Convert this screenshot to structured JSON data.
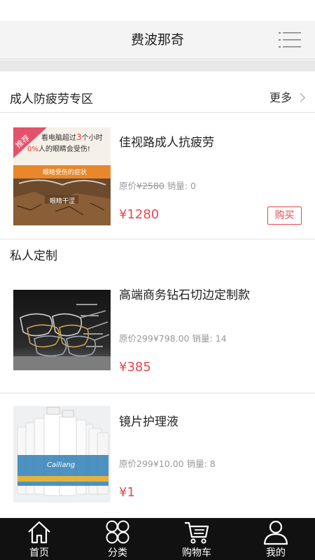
{
  "header": {
    "title": "费波那奇",
    "menu_icon": "menu-lines-icon"
  },
  "section1": {
    "title": "成人防疲劳专区",
    "more_label": "更多",
    "product": {
      "name": "佳视路成人抗疲劳",
      "original_price_label": "原价",
      "original_price": "¥2580",
      "sales_label": "销量:",
      "sales": "0",
      "price": "¥1280",
      "buy_label": "购买",
      "image": {
        "badge": "推荐",
        "line1_a": "看电脑超过",
        "line1_b": "3",
        "line1_c": "个小时",
        "line2_a": "0%",
        "line2_b": "人的眼睛会受伤!",
        "banner": "眼睛受伤的症状",
        "caption": "眼睛干涩"
      }
    }
  },
  "section2": {
    "title": "私人定制",
    "products": [
      {
        "name": "高端商务钻石切边定制款",
        "meta": "原价299¥798.00 销量: 14",
        "price": "¥385"
      },
      {
        "name": "镜片护理液",
        "meta": "原价299¥10.00 销量: 8",
        "price": "¥1",
        "image_brand": "Cailiang"
      }
    ]
  },
  "tabbar": {
    "items": [
      {
        "label": "首页",
        "icon": "home-icon"
      },
      {
        "label": "分类",
        "icon": "category-icon"
      },
      {
        "label": "购物车",
        "icon": "cart-icon"
      },
      {
        "label": "我的",
        "icon": "user-icon"
      }
    ]
  },
  "colors": {
    "price": "#e8474f",
    "tabbar_bg": "#111111",
    "header_bg": "#f4f4f4"
  }
}
